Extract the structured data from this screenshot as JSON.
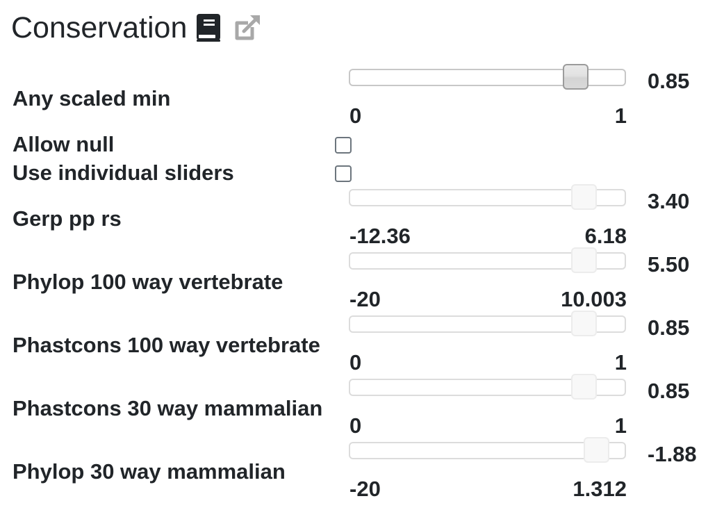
{
  "header": {
    "title": "Conservation",
    "icons": [
      "book-icon",
      "external-link-icon"
    ]
  },
  "any_scaled_min": {
    "label": "Any scaled min",
    "min": "0",
    "max": "1",
    "value": "0.85",
    "level": 0.85
  },
  "allow_null": {
    "label": "Allow null",
    "checked": false
  },
  "use_individual_sliders": {
    "label": "Use individual sliders",
    "checked": false
  },
  "sliders": [
    {
      "label": "Gerp pp rs",
      "min": "-12.36",
      "max": "6.18",
      "value": "3.40",
      "level": 0.85
    },
    {
      "label": "Phylop 100 way vertebrate",
      "min": "-20",
      "max": "10.003",
      "value": "5.50",
      "level": 0.85
    },
    {
      "label": "Phastcons 100 way vertebrate",
      "min": "0",
      "max": "1",
      "value": "0.85",
      "level": 0.85
    },
    {
      "label": "Phastcons 30 way mammalian",
      "min": "0",
      "max": "1",
      "value": "0.85",
      "level": 0.85
    },
    {
      "label": "Phylop 30 way mammalian",
      "min": "-20",
      "max": "1.312",
      "value": "-1.88",
      "level": 0.85
    }
  ],
  "colors": {
    "text": "#212529",
    "track_border": "#dcdcdc",
    "thumb_active_border": "#9b9b9b"
  }
}
